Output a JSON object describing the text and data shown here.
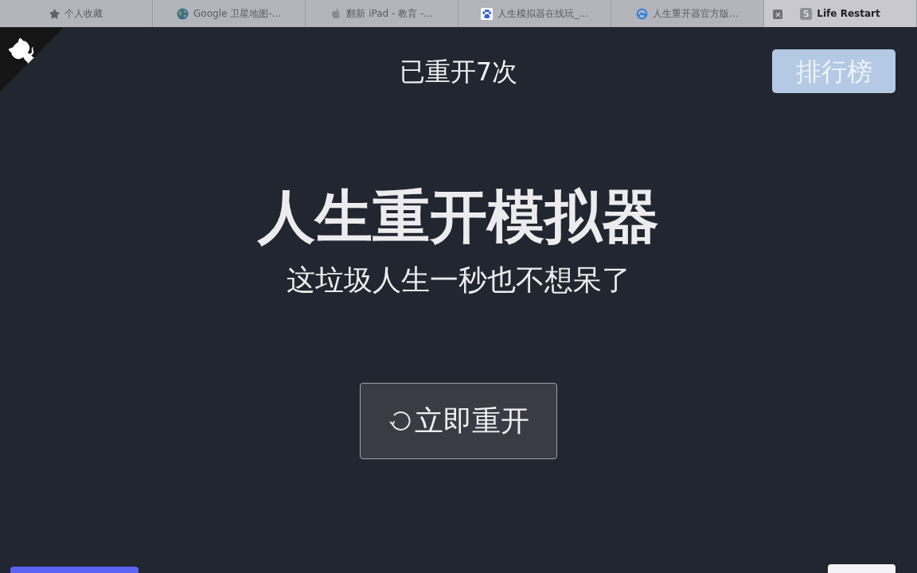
{
  "browser_tabs": [
    {
      "title": "个人收藏",
      "selected": false
    },
    {
      "title": "Google 卫星地图-...",
      "selected": false
    },
    {
      "title": "翻新 iPad - 教育 -...",
      "selected": false
    },
    {
      "title": "人生模拟器在线玩_...",
      "selected": false
    },
    {
      "title": "人生重开器官方版...",
      "selected": false
    },
    {
      "title": "Life Restart",
      "selected": true,
      "favicon_letter": "S"
    }
  ],
  "page": {
    "restart_count": "已重开7次",
    "leaderboard_button": "排行榜",
    "title": "人生重开模拟器",
    "subtitle": "这垃圾人生一秒也不想呆了",
    "restart_button": "立即重开"
  }
}
